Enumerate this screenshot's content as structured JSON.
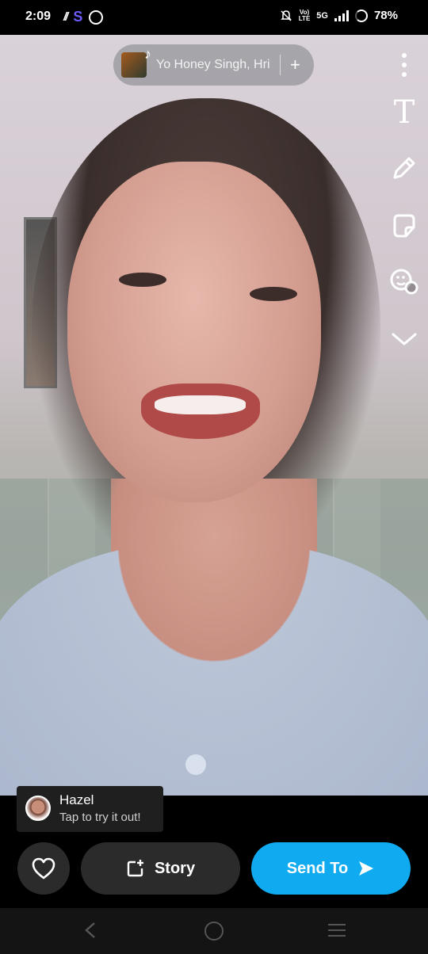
{
  "status_bar": {
    "time": "2:09",
    "volte": "Vo)\nLTE",
    "network": "5G",
    "battery": "78%"
  },
  "music": {
    "title": "Yo Honey Singh, Hri",
    "add_label": "+"
  },
  "tools": {
    "text_glyph": "T"
  },
  "lens": {
    "name": "Hazel",
    "hint": "Tap to try it out!"
  },
  "actions": {
    "story_label": "Story",
    "send_label": "Send To"
  },
  "colors": {
    "send_button": "#10aaf0",
    "dark_button": "#2b2b2b"
  }
}
